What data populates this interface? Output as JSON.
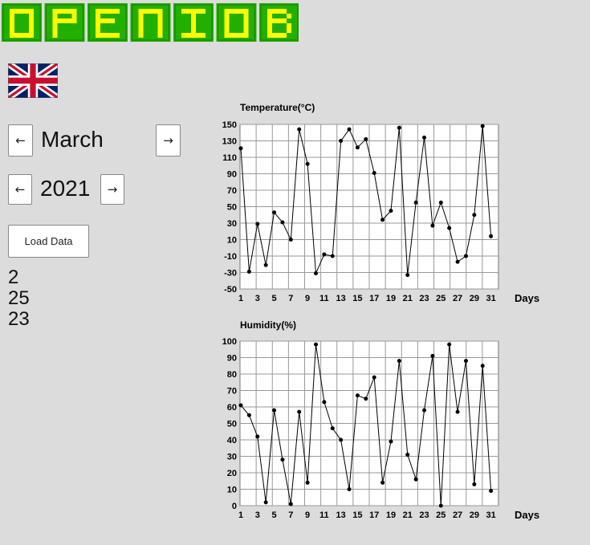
{
  "app": {
    "logo_text": "OPENIOB",
    "language_flag": "uk-flag-icon"
  },
  "controls": {
    "month": "March",
    "year": "2021",
    "prev_label": "←",
    "next_label": "→",
    "load_label": "Load Data"
  },
  "stats": [
    "2",
    "25",
    "23"
  ],
  "colors": {
    "background": "#dcdcdc",
    "logo_fill": "#ffff00",
    "logo_bg": "#22b000",
    "grid": "#999999",
    "line": "#000000"
  },
  "chart_data": [
    {
      "type": "line",
      "title": "Temperature(°C)",
      "xlabel": "Days",
      "ylabel": "",
      "x": [
        1,
        2,
        3,
        4,
        5,
        6,
        7,
        8,
        9,
        10,
        11,
        12,
        13,
        14,
        15,
        16,
        17,
        18,
        19,
        20,
        21,
        22,
        23,
        24,
        25,
        26,
        27,
        28,
        29,
        30,
        31
      ],
      "x_tick_labels": [
        "1",
        "3",
        "5",
        "7",
        "9",
        "11",
        "13",
        "15",
        "17",
        "19",
        "21",
        "23",
        "25",
        "27",
        "29",
        "31"
      ],
      "y_tick_labels": [
        "150",
        "130",
        "110",
        "90",
        "70",
        "50",
        "30",
        "10",
        "-10",
        "-30",
        "-50"
      ],
      "values": [
        121,
        -29,
        29,
        -21,
        43,
        31,
        10,
        144,
        102,
        -31,
        -8,
        -10,
        130,
        144,
        122,
        132,
        91,
        34,
        45,
        146,
        -33,
        55,
        134,
        27,
        55,
        24,
        -17,
        -10,
        40,
        148,
        14
      ],
      "ylim": [
        -50,
        150
      ],
      "grid": true
    },
    {
      "type": "line",
      "title": "Humidity(%)",
      "xlabel": "Days",
      "ylabel": "",
      "x": [
        1,
        2,
        3,
        4,
        5,
        6,
        7,
        8,
        9,
        10,
        11,
        12,
        13,
        14,
        15,
        16,
        17,
        18,
        19,
        20,
        21,
        22,
        23,
        24,
        25,
        26,
        27,
        28,
        29,
        30,
        31
      ],
      "x_tick_labels": [
        "1",
        "3",
        "5",
        "7",
        "9",
        "11",
        "13",
        "15",
        "17",
        "19",
        "21",
        "23",
        "25",
        "27",
        "29",
        "31"
      ],
      "y_tick_labels": [
        "100",
        "90",
        "80",
        "70",
        "60",
        "50",
        "40",
        "30",
        "20",
        "10",
        "0"
      ],
      "values": [
        61,
        55,
        42,
        2,
        58,
        28,
        1,
        57,
        14,
        98,
        63,
        47,
        40,
        10,
        67,
        65,
        78,
        14,
        39,
        88,
        31,
        16,
        58,
        91,
        0,
        98,
        57,
        88,
        13,
        85,
        9
      ],
      "ylim": [
        0,
        100
      ],
      "grid": true
    }
  ]
}
